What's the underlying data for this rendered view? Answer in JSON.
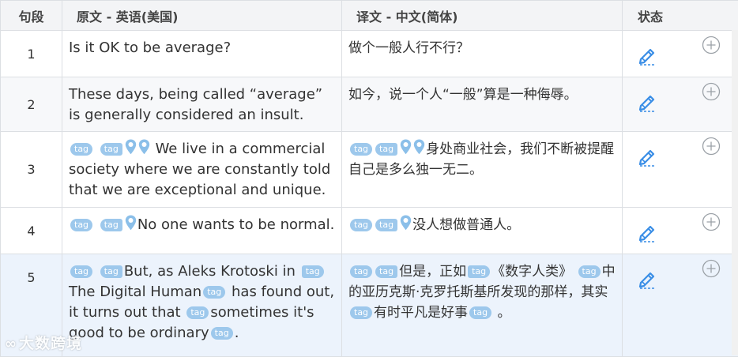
{
  "header": {
    "index": "句段",
    "source": "原文 - 英语(美国)",
    "target": "译文 - 中文(简体)",
    "status": "状态"
  },
  "tag_label": "tag",
  "watermark": "大数跨境",
  "rows": [
    {
      "index": "1",
      "source": "Is it OK to be average?",
      "target": "做个一般人行不行？"
    },
    {
      "index": "2",
      "source": "These days, being called “average” is generally considered an insult.",
      "target": "如今，说一个人“一般”算是一种侮辱。"
    },
    {
      "index": "3",
      "source": "We live in a commercial society where we are constantly told that we are exceptional and unique.",
      "target": "身处商业社会，我们不断被提醒自己是多么独一无二。"
    },
    {
      "index": "4",
      "source": "No one wants to be normal.",
      "target": "没人想做普通人。"
    },
    {
      "index": "5",
      "source_parts": [
        "But, as Aleks Krotoski in",
        "The Digital Human",
        "has found out, it turns out that",
        "sometimes it's good to be ordinary",
        "."
      ],
      "target_parts": [
        "但是，正如",
        "《数字人类》",
        "中的亚历克斯·克罗托斯基所发现的那样，其实",
        "有时平凡是好事",
        "。"
      ]
    }
  ],
  "colors": {
    "tag": "#9dc8ec",
    "pin": "#8bbfe9",
    "edit_icon": "#3a8ee6",
    "add_icon": "#9aa0a6",
    "selected_row": "#ecf3fc"
  }
}
